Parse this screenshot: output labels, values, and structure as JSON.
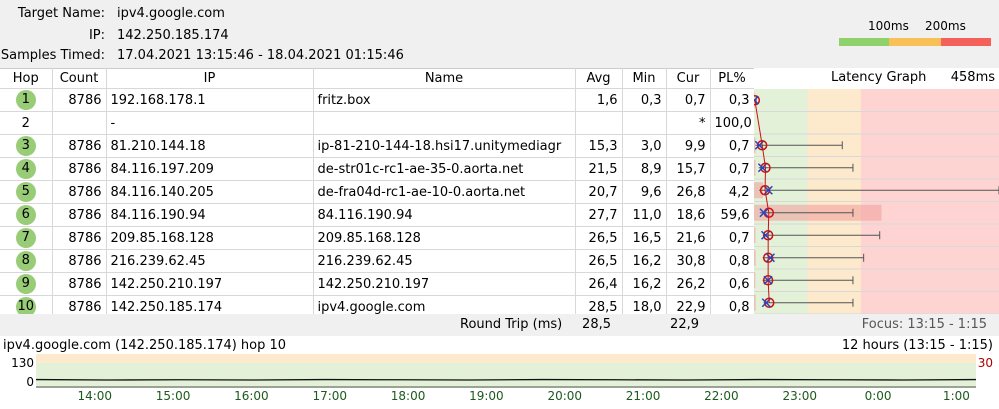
{
  "header": {
    "target_label": "Target Name:",
    "target_value": "ipv4.google.com",
    "ip_label": "IP:",
    "ip_value": "142.250.185.174",
    "samples_label": "Samples Timed:",
    "samples_value": "17.04.2021 13:15:46 - 18.04.2021 01:15:46",
    "legend_100": "100ms",
    "legend_200": "200ms",
    "legend_colors": [
      "#8fd16a",
      "#f8c157",
      "#f4605a"
    ]
  },
  "table": {
    "columns": [
      "Hop",
      "Count",
      "IP",
      "Name",
      "Avg",
      "Min",
      "Cur",
      "PL%",
      "Latency Graph",
      "458ms"
    ],
    "rows": [
      {
        "hop": "1",
        "count": "8786",
        "ip": "192.168.178.1",
        "name": "fritz.box",
        "avg": "1,6",
        "min": "0,3",
        "cur": "0,7",
        "pl": "0,3"
      },
      {
        "hop": "2",
        "count": "",
        "ip": "-",
        "name": "",
        "avg": "",
        "min": "",
        "cur": "*",
        "pl": "100,0"
      },
      {
        "hop": "3",
        "count": "8786",
        "ip": "81.210.144.18",
        "name": "ip-81-210-144-18.hsi17.unitymediagr",
        "avg": "15,3",
        "min": "3,0",
        "cur": "9,9",
        "pl": "0,7"
      },
      {
        "hop": "4",
        "count": "8786",
        "ip": "84.116.197.209",
        "name": "de-str01c-rc1-ae-35-0.aorta.net",
        "avg": "21,5",
        "min": "8,9",
        "cur": "15,7",
        "pl": "0,7"
      },
      {
        "hop": "5",
        "count": "8786",
        "ip": "84.116.140.205",
        "name": "de-fra04d-rc1-ae-10-0.aorta.net",
        "avg": "20,7",
        "min": "9,6",
        "cur": "26,8",
        "pl": "4,2"
      },
      {
        "hop": "6",
        "count": "8786",
        "ip": "84.116.190.94",
        "name": "84.116.190.94",
        "avg": "27,7",
        "min": "11,0",
        "cur": "18,6",
        "pl": "59,6"
      },
      {
        "hop": "7",
        "count": "8786",
        "ip": "209.85.168.128",
        "name": "209.85.168.128",
        "avg": "26,5",
        "min": "16,5",
        "cur": "21,6",
        "pl": "0,7"
      },
      {
        "hop": "8",
        "count": "8786",
        "ip": "216.239.62.45",
        "name": "216.239.62.45",
        "avg": "26,5",
        "min": "16,2",
        "cur": "30,8",
        "pl": "0,8"
      },
      {
        "hop": "9",
        "count": "8786",
        "ip": "142.250.210.197",
        "name": "142.250.210.197",
        "avg": "26,4",
        "min": "16,2",
        "cur": "26,2",
        "pl": "0,6"
      },
      {
        "hop": "10",
        "count": "8786",
        "ip": "142.250.185.174",
        "name": "ipv4.google.com",
        "avg": "28,5",
        "min": "18,0",
        "cur": "22,9",
        "pl": "0,8"
      }
    ],
    "hops_with_badge": [
      true,
      false,
      true,
      true,
      true,
      true,
      true,
      true,
      true,
      true
    ],
    "max_latency_ms": [
      4,
      null,
      165,
      185,
      550,
      185,
      235,
      205,
      185,
      185
    ],
    "footer": {
      "label": "Round Trip (ms)",
      "avg": "28,5",
      "cur": "22,9",
      "focus": "Focus: 13:15 - 1:15"
    }
  },
  "timeline": {
    "title": "ipv4.google.com (142.250.185.174) hop 10",
    "range": "12 hours (13:15 - 1:15)",
    "y_top": "130",
    "y_zero": "0",
    "y_right": "30",
    "ticks": [
      "14:00",
      "15:00",
      "16:00",
      "17:00",
      "18:00",
      "19:00",
      "20:00",
      "21:00",
      "22:00",
      "23:00",
      "0:00",
      "1:00"
    ]
  },
  "chart_data": {
    "type": "line",
    "title": "",
    "x": [
      "13:15",
      "14:00",
      "15:00",
      "16:00",
      "17:00",
      "18:00",
      "19:00",
      "20:00",
      "21:00",
      "22:00",
      "23:00",
      "0:00",
      "1:00",
      "1:15"
    ],
    "series": [
      {
        "name": "",
        "values": [
          28,
          26,
          27,
          26,
          28,
          27,
          26,
          28,
          27,
          26,
          28,
          27,
          26,
          28
        ]
      }
    ],
    "ylim": [
      0,
      130
    ],
    "grid": false
  }
}
